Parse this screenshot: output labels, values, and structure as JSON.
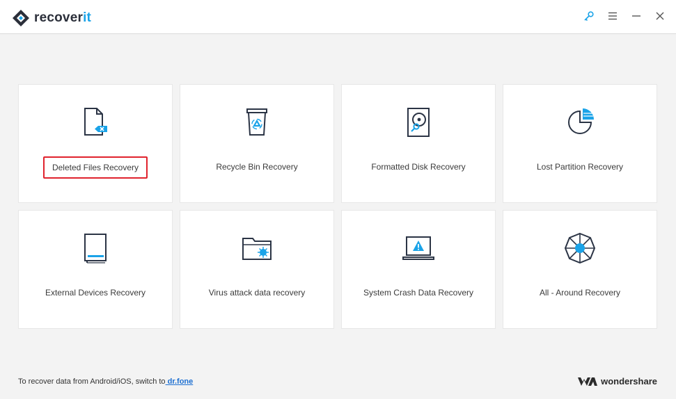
{
  "app": {
    "name_main": "recover",
    "name_accent": "it"
  },
  "window_controls": [
    {
      "name": "key-icon"
    },
    {
      "name": "menu-icon"
    },
    {
      "name": "minimize-icon"
    },
    {
      "name": "close-icon"
    }
  ],
  "cards": [
    {
      "label": "Deleted Files Recovery",
      "icon": "deleted-file-icon",
      "selected": true
    },
    {
      "label": "Recycle Bin Recovery",
      "icon": "recycle-bin-icon"
    },
    {
      "label": "Formatted Disk Recovery",
      "icon": "formatted-disk-icon"
    },
    {
      "label": "Lost Partition Recovery",
      "icon": "lost-partition-icon"
    },
    {
      "label": "External Devices Recovery",
      "icon": "external-device-icon"
    },
    {
      "label": "Virus attack data recovery",
      "icon": "virus-folder-icon"
    },
    {
      "label": "System Crash Data Recovery",
      "icon": "crashed-laptop-icon"
    },
    {
      "label": "All - Around Recovery",
      "icon": "all-around-icon"
    }
  ],
  "footer": {
    "prefix": "To recover data from Android/iOS, switch to",
    "link": " dr.fone",
    "brand": "wondershare"
  },
  "colors": {
    "accent": "#1aa3e8",
    "selection_border": "#e0222d",
    "icon_dark": "#2b3445"
  }
}
